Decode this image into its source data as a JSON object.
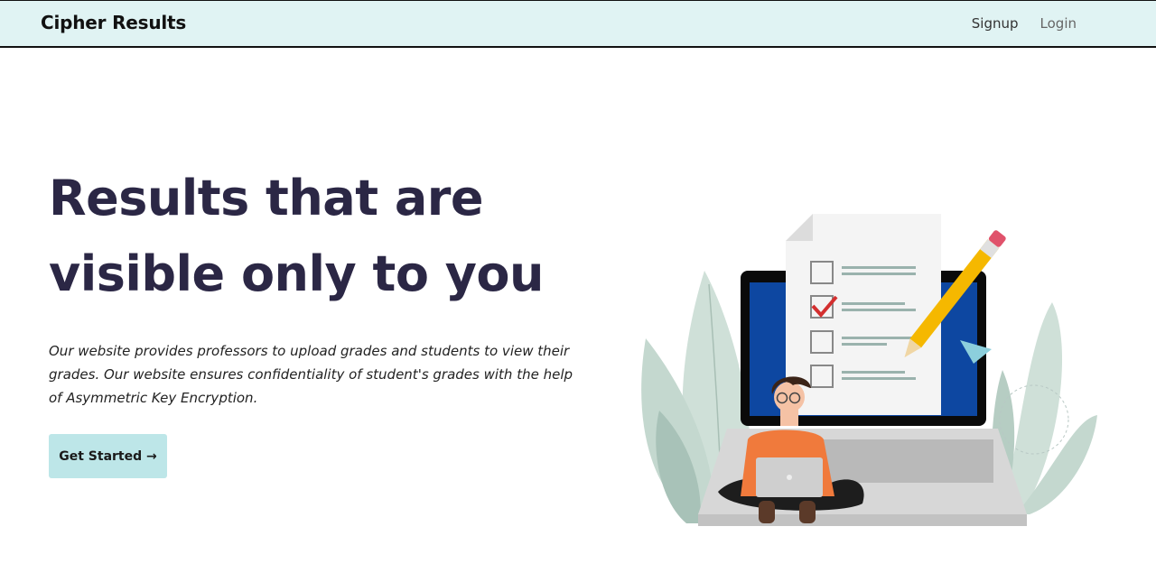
{
  "nav": {
    "brand": "Cipher Results",
    "links": [
      {
        "label": "Signup"
      },
      {
        "label": "Login"
      }
    ]
  },
  "hero": {
    "title": "Results that are visible only to you",
    "description": "Our website provides professors to upload grades and students to view their grades. Our website ensures confidentiality of student's grades with the help of Asymmetric Key Encryption.",
    "cta_label": "Get Started →"
  },
  "colors": {
    "navbar_bg": "#e0f3f3",
    "title": "#2b2745",
    "cta_bg": "#bde6e8",
    "laptop_screen": "#0d47a1",
    "pencil": "#f5b800",
    "shirt": "#f07a3c"
  }
}
